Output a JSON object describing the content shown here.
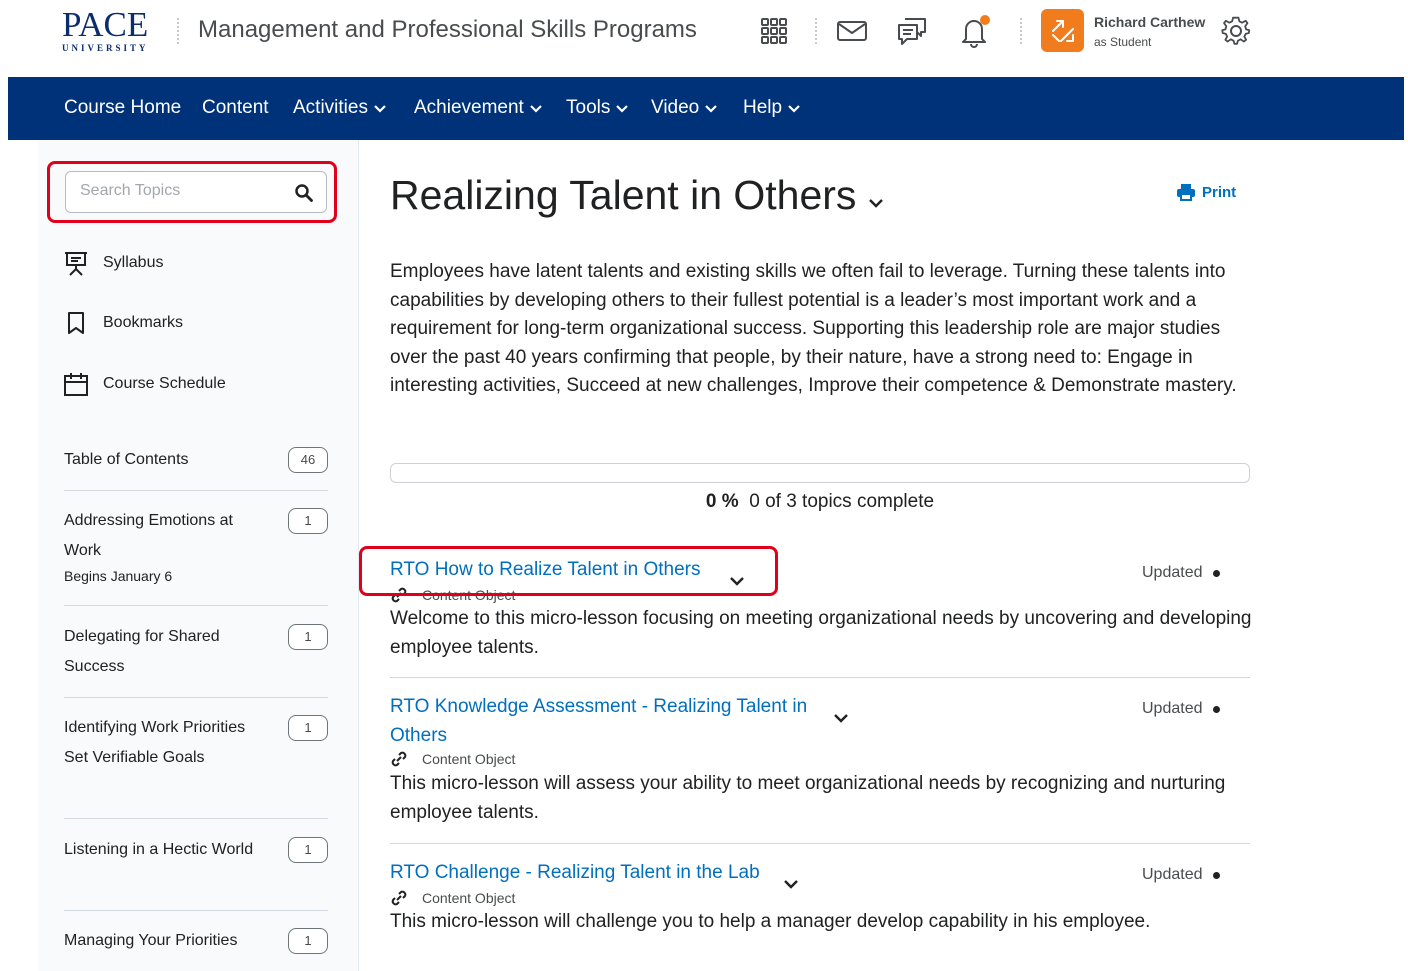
{
  "header": {
    "logo_main": "PACE",
    "logo_sub": "UNIVERSITY",
    "course_title": "Management and Professional Skills Programs",
    "user_name": "Richard Carthew",
    "user_role": "as Student",
    "avatar_color": "#f07c1d",
    "icons": [
      "waffle-icon",
      "mail-icon",
      "chat-icon",
      "bell-icon",
      "gear-icon"
    ],
    "notification_dot_color": "#f07c1d"
  },
  "nav": {
    "items": [
      {
        "label": "Course Home",
        "dropdown": false
      },
      {
        "label": "Content",
        "dropdown": false
      },
      {
        "label": "Activities",
        "dropdown": true
      },
      {
        "label": "Achievement",
        "dropdown": true
      },
      {
        "label": "Tools",
        "dropdown": true
      },
      {
        "label": "Video",
        "dropdown": true
      },
      {
        "label": "Help",
        "dropdown": true
      }
    ],
    "bg_color": "#00327a"
  },
  "sidebar": {
    "search_placeholder": "Search Topics",
    "links": [
      {
        "label": "Syllabus",
        "icon": "presentation-icon"
      },
      {
        "label": "Bookmarks",
        "icon": "bookmark-icon"
      },
      {
        "label": "Course Schedule",
        "icon": "calendar-icon"
      }
    ],
    "toc": [
      {
        "label": "Table of Contents",
        "count": "46",
        "sub": ""
      },
      {
        "label": "Addressing Emotions at Work",
        "count": "1",
        "sub": "Begins January 6"
      },
      {
        "label": "Delegating for Shared Success",
        "count": "1",
        "sub": ""
      },
      {
        "label": "Identifying Work Priorities Set Verifiable Goals",
        "count": "1",
        "sub": ""
      },
      {
        "label": "Listening in a Hectic World",
        "count": "1",
        "sub": ""
      },
      {
        "label": "Managing Your Priorities",
        "count": "1",
        "sub": ""
      }
    ]
  },
  "main": {
    "title": "Realizing Talent in Others",
    "print_label": "Print",
    "description": "Employees have latent talents and existing skills we often fail to leverage. Turning these talents into capabilities by developing others to their fullest potential is a leader’s most important work and a requirement for long-term organizational success. Supporting this leadership role are major studies over the past 40 years confirming that people, by their nature, have a strong need to: Engage in interesting activities, Succeed at new challenges, Improve their competence & Demonstrate mastery.",
    "progress": {
      "percent_label": "0 %",
      "summary": "0 of 3 topics complete",
      "fraction": 0
    },
    "topics": [
      {
        "title": "RTO How to Realize Talent in Others",
        "type": "Content Object",
        "status": "Updated",
        "description": "Welcome to this micro-lesson focusing on meeting organizational needs by uncovering and developing employee talents."
      },
      {
        "title": "RTO Knowledge Assessment - Realizing Talent in Others",
        "type": "Content Object",
        "status": "Updated",
        "description": "This micro-lesson will assess your ability to meet organizational needs by recognizing and nurturing employee talents."
      },
      {
        "title": "RTO Challenge - Realizing Talent in the Lab",
        "type": "Content Object",
        "status": "Updated",
        "description": "This micro-lesson will challenge you to help a manager develop capability in his employee."
      }
    ],
    "link_color": "#006fbf",
    "highlight_color": "#e0001b"
  }
}
